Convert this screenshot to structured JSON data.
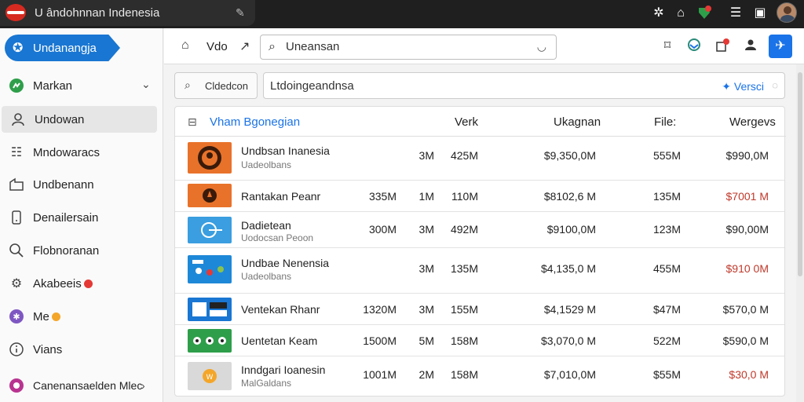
{
  "window": {
    "tab_title": "U ἀndohnnan Indenesia",
    "tab_title_clean": "U ândohnnan Indenesia"
  },
  "colors": {
    "accent": "#1976d2",
    "titlebar": "#1f1f1f",
    "warn": "#c0392b"
  },
  "sidebar": {
    "top": {
      "label": "Undanangja",
      "icon": "star-icon"
    },
    "items": [
      {
        "label": "Markan",
        "icon": "person-green-icon",
        "chevron": true
      },
      {
        "label": "Undowan",
        "icon": "user-icon",
        "active": true
      },
      {
        "label": "Mndowaracs",
        "icon": "list-icon"
      },
      {
        "label": "Undbenann",
        "icon": "folder-icon"
      },
      {
        "label": "Denailersain",
        "icon": "phone-icon"
      },
      {
        "label": "Flobnoranan",
        "icon": "search-icon"
      },
      {
        "label": "Akabeeis",
        "icon": "gear-icon",
        "badge_color": "#e53935"
      },
      {
        "label": "Me",
        "icon": "puzzle-icon",
        "badge_color": "#f4a62a"
      },
      {
        "label": "Vians",
        "icon": "info-icon"
      },
      {
        "label": "Canenansaelden Mlec",
        "icon": "apps-icon",
        "chevron": true
      }
    ]
  },
  "toolbar": {
    "vdo_label": "Vdo",
    "search_value": "Uneansan"
  },
  "filter": {
    "button_label": "Cldedcon",
    "input_value": "Ltdoingeandnsa",
    "version_label": "Versci"
  },
  "table": {
    "headers": {
      "name": "Vham Bgonegian",
      "c1": "Verk",
      "c2": "Ukagnan",
      "c3": "File:",
      "c4": "Wergevs"
    },
    "rows": [
      {
        "name": "Undbsan Inanesia",
        "sub": "Uadeolbans",
        "a": "",
        "b": "3M",
        "c": "425M",
        "d": "$9,350,0M",
        "e": "555M",
        "f": "$990,0M",
        "f_red": false
      },
      {
        "name": "Rantakan Peanr",
        "sub": "",
        "a": "335M",
        "b": "1M",
        "c": "110M",
        "d": "$8102,6 M",
        "e": "135M",
        "f": "$7001 M",
        "f_red": true
      },
      {
        "name": "Dadietean",
        "sub": "Uodocsan Peoon",
        "a": "300M",
        "b": "3M",
        "c": "492M",
        "d": "$9100,0M",
        "e": "123M",
        "f": "$90,00M",
        "f_red": false
      },
      {
        "name": "Undbae Nenensia",
        "sub": "Uadeolbans",
        "a": "",
        "b": "3M",
        "c": "135M",
        "d": "$4,135,0 M",
        "e": "455M",
        "f": "$910 0M",
        "f_red": true
      },
      {
        "name": "Ventekan Rhanr",
        "sub": "",
        "a": "1320M",
        "b": "3M",
        "c": "155M",
        "d": "$4,1529 M",
        "e": "$47M",
        "f": "$570,0 M",
        "f_red": false
      },
      {
        "name": "Uentetan Keam",
        "sub": "",
        "a": "1500M",
        "b": "5M",
        "c": "158M",
        "d": "$3,070,0 M",
        "e": "522M",
        "f": "$590,0 M",
        "f_red": false
      },
      {
        "name": "Inndgari Ioanesin",
        "sub": "MalGaldans",
        "a": "1001M",
        "b": "2M",
        "c": "158M",
        "d": "$7,010,0M",
        "e": "$55M",
        "f": "$30,0 M",
        "f_red": true
      }
    ]
  }
}
